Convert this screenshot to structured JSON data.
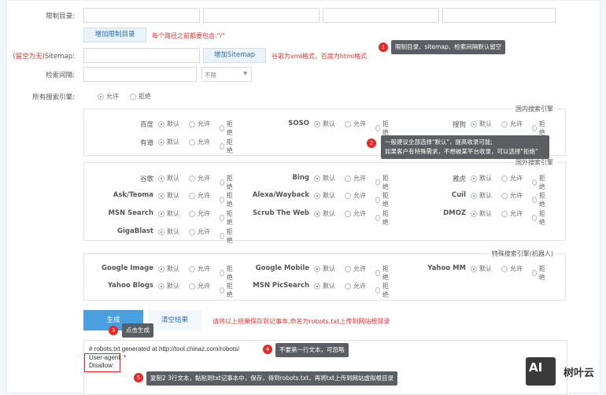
{
  "form": {
    "restrict_label": "限制目录:",
    "add_restrict_btn": "增加限制目录",
    "restrict_hint": "每个路径之前都要包含:\"/\"",
    "sitemap_label_prefix": "(留空为无)",
    "sitemap_label": "Sitemap:",
    "add_sitemap_btn": "增加Sitemap",
    "sitemap_hint": "谷歌为xml格式，百度为html格式",
    "interval_label": "检索间隔:",
    "interval_select": "不限",
    "all_engines_label": "所有搜索引擎:",
    "all_allow": "允许",
    "all_deny": "拒绝"
  },
  "options": {
    "default": "默认",
    "allow": "允许",
    "deny": "拒绝"
  },
  "groups": [
    {
      "legend": "国内搜索引擎",
      "engines": [
        "百度",
        "SOSO",
        "搜狗",
        "有道"
      ]
    },
    {
      "legend": "国外搜索引擎",
      "engines": [
        "谷歌",
        "Bing",
        "雅虎",
        "Ask/Teoma",
        "Alexa/Wayback",
        "Cuil",
        "MSN Search",
        "Scrub The Web",
        "DMOZ",
        "GigaBlast"
      ]
    },
    {
      "legend": "特殊搜索引擎(机器人)",
      "engines": [
        "Google Image",
        "Google Mobile",
        "Yahoo MM",
        "Yahoo Blogs",
        "MSN PicSearch"
      ]
    }
  ],
  "actions": {
    "generate": "生成",
    "clear": "清空结果",
    "hint": "请将以上结果保存到记事本,命名为robots.txt上传到网站根目录"
  },
  "result": {
    "line1": "# robots.txt generated at http://tool.chinaz.com/robots/",
    "line2": "User-agent: *",
    "line3": "Disallow:"
  },
  "tips": [
    {
      "n": "1",
      "text": "限制目录、sitemap、检索间隔默认留空"
    },
    {
      "n": "2",
      "text1": "一般建议全部选择\"默认\"，提高收录可能;",
      "text2": "如果客户有特殊需求，不想被某平台收录，可以选择\"拒绝\""
    },
    {
      "n": "3",
      "text": "点击生成"
    },
    {
      "n": "4",
      "text": "不要第一行文本，可忽略"
    },
    {
      "n": "5",
      "text": "复制2 3行文本，黏贴到txt记事本中，保存，得到robots.txt，再将txt上传到网站虚拟根目录"
    }
  ],
  "watermark": {
    "logo": "AI",
    "name": "树叶云"
  },
  "colors": {
    "accent": "#4a9fe0",
    "hint": "#e33333",
    "tooltip": "#5b5f63",
    "badge": "#e52929"
  }
}
